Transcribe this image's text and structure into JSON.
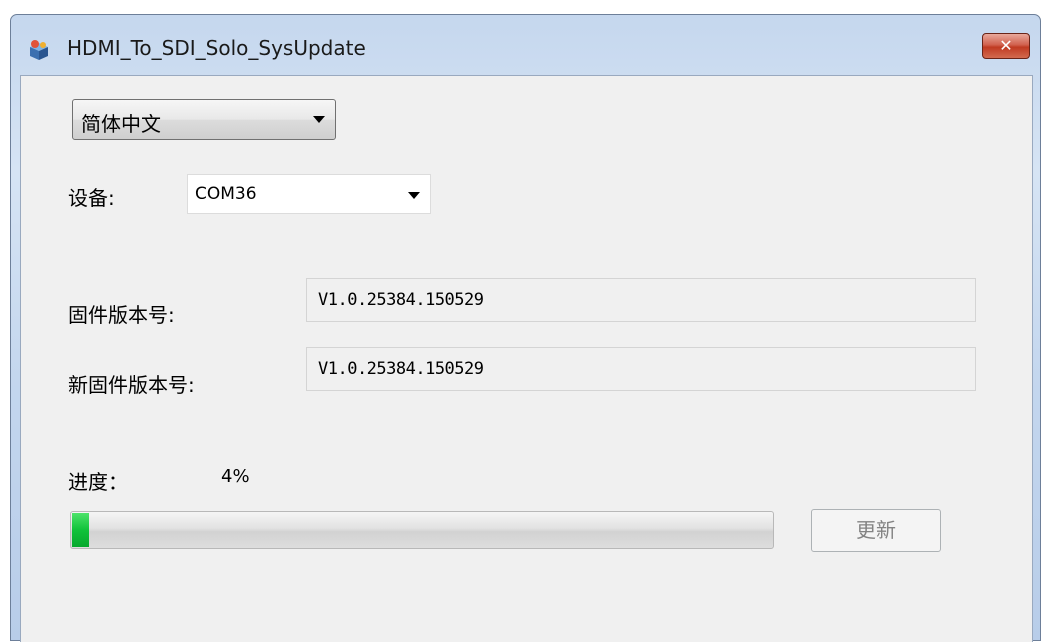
{
  "window": {
    "title": "HDMI_To_SDI_Solo_SysUpdate",
    "close_label": "✕",
    "app_icon": "installer-box-icon"
  },
  "language": {
    "selected": "简体中文",
    "arrow": "chevron-down-icon"
  },
  "device": {
    "label": "设备:",
    "selected": "COM36"
  },
  "firmware": {
    "current_label": "固件版本号:",
    "current_value": "V1.0.25384.150529",
    "new_label": "新固件版本号:",
    "new_value": "V1.0.25384.150529"
  },
  "progress": {
    "label": "进度：",
    "percent_text": "4%",
    "value": 0.04
  },
  "update_button": {
    "label": "更新",
    "enabled": false
  }
}
